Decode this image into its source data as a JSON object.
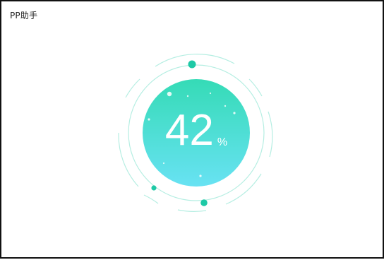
{
  "window": {
    "title": "PP助手"
  },
  "progress": {
    "value": 42,
    "value_text": "42",
    "unit": "%"
  },
  "colors": {
    "gradient_top": "#35dbb6",
    "gradient_bottom": "#68e2f3",
    "accent": "#1ec9a6",
    "ring": "#8fe6d3",
    "border": "#111111"
  }
}
